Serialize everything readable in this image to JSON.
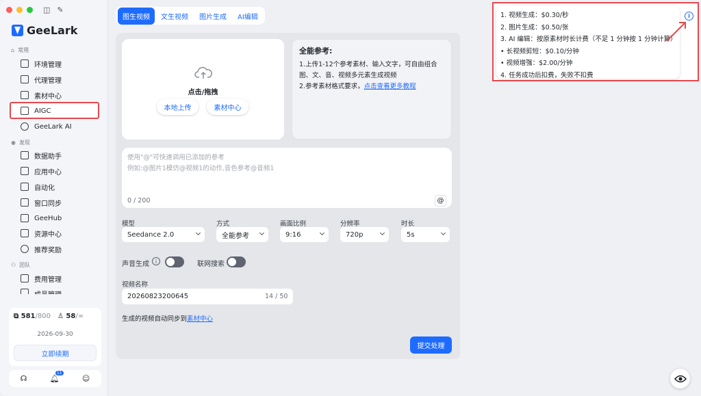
{
  "app": {
    "name": "GeeLark"
  },
  "sidebar": {
    "sections": [
      {
        "label": "常用"
      },
      {
        "label": "发现"
      },
      {
        "label": "团队"
      }
    ],
    "items": [
      {
        "label": "环境管理"
      },
      {
        "label": "代理管理"
      },
      {
        "label": "素材中心"
      },
      {
        "label": "AIGC"
      },
      {
        "label": "GeeLark AI"
      },
      {
        "label": "数据助手"
      },
      {
        "label": "应用中心"
      },
      {
        "label": "自动化"
      },
      {
        "label": "窗口同步"
      },
      {
        "label": "GeeHub"
      },
      {
        "label": "资源中心"
      },
      {
        "label": "推荐奖励"
      },
      {
        "label": "费用管理"
      },
      {
        "label": "成员管理"
      }
    ],
    "footer": {
      "profiles_used": "581",
      "profiles_total": "/800",
      "members_used": "58",
      "members_total": "/∞",
      "expiry_date": "2026-09-30",
      "renew_label": "立即续期",
      "notification_count": "11"
    }
  },
  "tabs": [
    {
      "label": "图生视频"
    },
    {
      "label": "文生视频"
    },
    {
      "label": "图片生成"
    },
    {
      "label": "AI编辑"
    }
  ],
  "upload": {
    "label": "点击/拖拽",
    "local_upload": "本地上传",
    "material_center": "素材中心"
  },
  "reference": {
    "title": "全能参考:",
    "line1": "1.上传1-12个参考素材、输入文字，可自由组合",
    "line2": "图、文、音、视频多元素生成视频",
    "line3_prefix": "2.参考素材格式要求，",
    "line3_link": "点击查看更多教程"
  },
  "prompt": {
    "placeholder1": "使用\"@\"可快速调用已添加的参考",
    "placeholder2": "例如:@图片1模仿@视频1的动作,音色参考@音频1",
    "counter": "0 / 200",
    "at_label": "@"
  },
  "fields": {
    "model": {
      "label": "模型",
      "value": "Seedance 2.0"
    },
    "mode": {
      "label": "方式",
      "value": "全能参考"
    },
    "ratio": {
      "label": "画面比例",
      "value": "9:16"
    },
    "resolution": {
      "label": "分辨率",
      "value": "720p"
    },
    "duration": {
      "label": "时长",
      "value": "5s"
    }
  },
  "toggles": {
    "sound": {
      "label": "声音生成",
      "on": false
    },
    "web_search": {
      "label": "联网搜索",
      "on": false
    }
  },
  "video_name": {
    "label": "视频名称",
    "value": "20260823200645",
    "counter": "14 / 50"
  },
  "sync_note": {
    "prefix": "生成的视频自动同步到",
    "link": "素材中心"
  },
  "submit_label": "提交处理",
  "pricing": [
    "1. 视频生成：$0.30/秒",
    "2. 图片生成：$0.50/张",
    "3. AI 编辑：按原素材时长计费（不足 1 分钟按 1 分钟计算）",
    "• 长视频剪短：$0.10/分钟",
    "• 视频增强：$2.00/分钟",
    "4. 任务成功后扣费，失败不扣费"
  ],
  "colors": {
    "accent": "#1e6bff",
    "highlight": "#e5484d"
  }
}
